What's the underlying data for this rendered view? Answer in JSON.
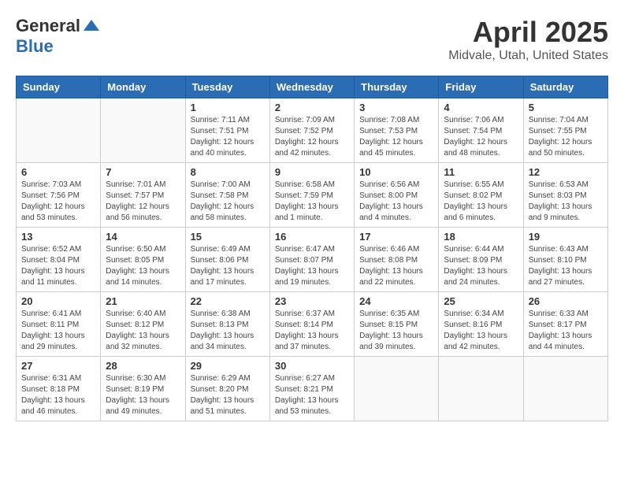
{
  "header": {
    "logo_general": "General",
    "logo_blue": "Blue",
    "title": "April 2025",
    "location": "Midvale, Utah, United States"
  },
  "weekdays": [
    "Sunday",
    "Monday",
    "Tuesday",
    "Wednesday",
    "Thursday",
    "Friday",
    "Saturday"
  ],
  "weeks": [
    [
      {
        "day": "",
        "info": ""
      },
      {
        "day": "",
        "info": ""
      },
      {
        "day": "1",
        "info": "Sunrise: 7:11 AM\nSunset: 7:51 PM\nDaylight: 12 hours and 40 minutes."
      },
      {
        "day": "2",
        "info": "Sunrise: 7:09 AM\nSunset: 7:52 PM\nDaylight: 12 hours and 42 minutes."
      },
      {
        "day": "3",
        "info": "Sunrise: 7:08 AM\nSunset: 7:53 PM\nDaylight: 12 hours and 45 minutes."
      },
      {
        "day": "4",
        "info": "Sunrise: 7:06 AM\nSunset: 7:54 PM\nDaylight: 12 hours and 48 minutes."
      },
      {
        "day": "5",
        "info": "Sunrise: 7:04 AM\nSunset: 7:55 PM\nDaylight: 12 hours and 50 minutes."
      }
    ],
    [
      {
        "day": "6",
        "info": "Sunrise: 7:03 AM\nSunset: 7:56 PM\nDaylight: 12 hours and 53 minutes."
      },
      {
        "day": "7",
        "info": "Sunrise: 7:01 AM\nSunset: 7:57 PM\nDaylight: 12 hours and 56 minutes."
      },
      {
        "day": "8",
        "info": "Sunrise: 7:00 AM\nSunset: 7:58 PM\nDaylight: 12 hours and 58 minutes."
      },
      {
        "day": "9",
        "info": "Sunrise: 6:58 AM\nSunset: 7:59 PM\nDaylight: 13 hours and 1 minute."
      },
      {
        "day": "10",
        "info": "Sunrise: 6:56 AM\nSunset: 8:00 PM\nDaylight: 13 hours and 4 minutes."
      },
      {
        "day": "11",
        "info": "Sunrise: 6:55 AM\nSunset: 8:02 PM\nDaylight: 13 hours and 6 minutes."
      },
      {
        "day": "12",
        "info": "Sunrise: 6:53 AM\nSunset: 8:03 PM\nDaylight: 13 hours and 9 minutes."
      }
    ],
    [
      {
        "day": "13",
        "info": "Sunrise: 6:52 AM\nSunset: 8:04 PM\nDaylight: 13 hours and 11 minutes."
      },
      {
        "day": "14",
        "info": "Sunrise: 6:50 AM\nSunset: 8:05 PM\nDaylight: 13 hours and 14 minutes."
      },
      {
        "day": "15",
        "info": "Sunrise: 6:49 AM\nSunset: 8:06 PM\nDaylight: 13 hours and 17 minutes."
      },
      {
        "day": "16",
        "info": "Sunrise: 6:47 AM\nSunset: 8:07 PM\nDaylight: 13 hours and 19 minutes."
      },
      {
        "day": "17",
        "info": "Sunrise: 6:46 AM\nSunset: 8:08 PM\nDaylight: 13 hours and 22 minutes."
      },
      {
        "day": "18",
        "info": "Sunrise: 6:44 AM\nSunset: 8:09 PM\nDaylight: 13 hours and 24 minutes."
      },
      {
        "day": "19",
        "info": "Sunrise: 6:43 AM\nSunset: 8:10 PM\nDaylight: 13 hours and 27 minutes."
      }
    ],
    [
      {
        "day": "20",
        "info": "Sunrise: 6:41 AM\nSunset: 8:11 PM\nDaylight: 13 hours and 29 minutes."
      },
      {
        "day": "21",
        "info": "Sunrise: 6:40 AM\nSunset: 8:12 PM\nDaylight: 13 hours and 32 minutes."
      },
      {
        "day": "22",
        "info": "Sunrise: 6:38 AM\nSunset: 8:13 PM\nDaylight: 13 hours and 34 minutes."
      },
      {
        "day": "23",
        "info": "Sunrise: 6:37 AM\nSunset: 8:14 PM\nDaylight: 13 hours and 37 minutes."
      },
      {
        "day": "24",
        "info": "Sunrise: 6:35 AM\nSunset: 8:15 PM\nDaylight: 13 hours and 39 minutes."
      },
      {
        "day": "25",
        "info": "Sunrise: 6:34 AM\nSunset: 8:16 PM\nDaylight: 13 hours and 42 minutes."
      },
      {
        "day": "26",
        "info": "Sunrise: 6:33 AM\nSunset: 8:17 PM\nDaylight: 13 hours and 44 minutes."
      }
    ],
    [
      {
        "day": "27",
        "info": "Sunrise: 6:31 AM\nSunset: 8:18 PM\nDaylight: 13 hours and 46 minutes."
      },
      {
        "day": "28",
        "info": "Sunrise: 6:30 AM\nSunset: 8:19 PM\nDaylight: 13 hours and 49 minutes."
      },
      {
        "day": "29",
        "info": "Sunrise: 6:29 AM\nSunset: 8:20 PM\nDaylight: 13 hours and 51 minutes."
      },
      {
        "day": "30",
        "info": "Sunrise: 6:27 AM\nSunset: 8:21 PM\nDaylight: 13 hours and 53 minutes."
      },
      {
        "day": "",
        "info": ""
      },
      {
        "day": "",
        "info": ""
      },
      {
        "day": "",
        "info": ""
      }
    ]
  ]
}
